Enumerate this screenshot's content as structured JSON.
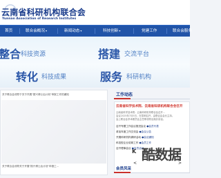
{
  "header": {
    "title_cn": "云南省科研机构联合会",
    "title_en": "Yunnan Association of Research Institutes"
  },
  "nav": {
    "items": [
      {
        "label": "首页"
      },
      {
        "label": "联合会概况"
      },
      {
        "label": "新闻动态"
      },
      {
        "label": "科技创新"
      },
      {
        "label": "党建工作"
      },
      {
        "label": "联合会服务"
      }
    ]
  },
  "banner": {
    "phrases": [
      {
        "big": "整合",
        "small": "科技资源"
      },
      {
        "big": "搭建",
        "small": "交流平台"
      },
      {
        "big": "转化",
        "small": "科技成果"
      },
      {
        "big": "服务",
        "small": "科研机构"
      }
    ]
  },
  "content": {
    "top_line": "关于联合会领导于关于开展\"振兴博士后计划\"申报工作的通知",
    "bottom_line": "关于联合会领导关于开展\"振兴博士后计划\"申报工..."
  },
  "sidebar": {
    "work_title": "工作动态",
    "news_head": "云南省科学技术院、云南省科研机构联合会召开",
    "news_body": [
      "云南省科学技术院：云南科研机构联合会召开...",
      "会议2025年7月5日，在昆明召开，由联合会会长主持。",
      "会上联合会学术委员会主任等领导出席并讲话。"
    ],
    "news_rows": [
      "召开专题工作会议推进会议",
      "参加年度工作交流会",
      "开展科研机构调研活动",
      "科技型企业培育工作",
      "召开理事会议"
    ],
    "row_suffixes": [
      "●会员代表",
      "●会议公告",
      "●会议通知",
      "●会员工作",
      "●会员活动"
    ],
    "member_title": "会员风采"
  },
  "watermark": {
    "text": "酷数据",
    "k": "K",
    "v": "V"
  },
  "pager": {
    "prev": "<",
    "next": ">"
  },
  "colors": {
    "nav_bg": "#2154a8",
    "brand": "#1a3c8c",
    "accent_red": "#c9302c"
  }
}
